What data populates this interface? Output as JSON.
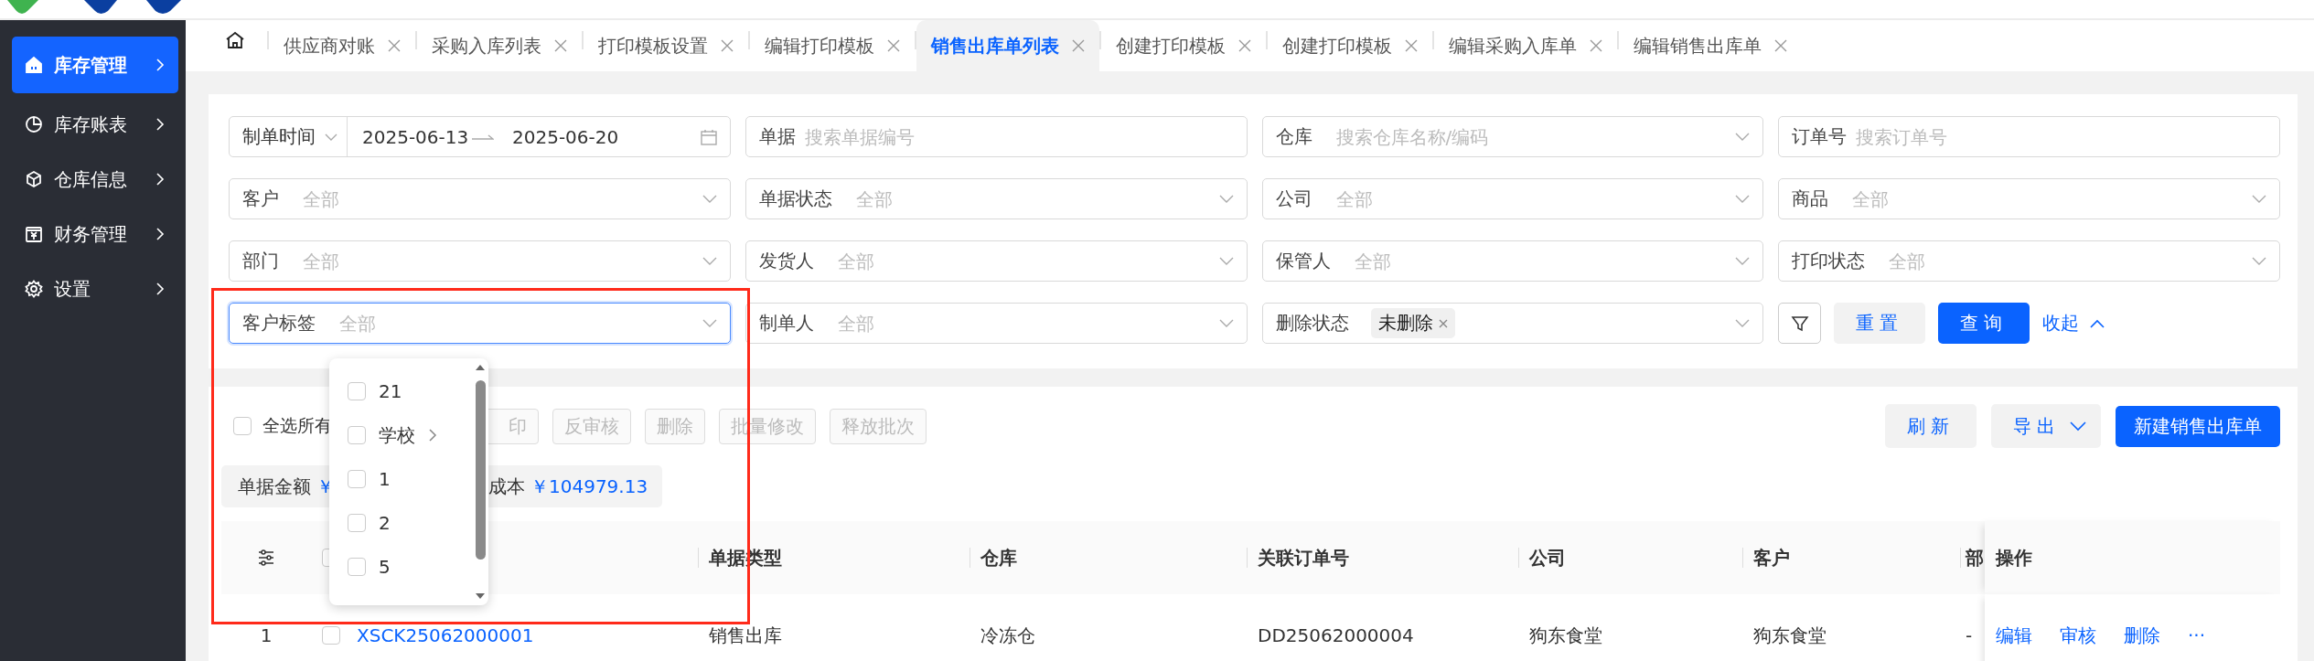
{
  "sidebar": {
    "items": [
      {
        "label": "库存管理",
        "selected": true
      },
      {
        "label": "库存账表",
        "selected": false
      },
      {
        "label": "仓库信息",
        "selected": false
      },
      {
        "label": "财务管理",
        "selected": false
      },
      {
        "label": "设置",
        "selected": false
      }
    ]
  },
  "tabs": [
    {
      "label": "供应商对账",
      "selected": false
    },
    {
      "label": "采购入库列表",
      "selected": false
    },
    {
      "label": "打印模板设置",
      "selected": false
    },
    {
      "label": "编辑打印模板",
      "selected": false
    },
    {
      "label": "销售出库单列表",
      "selected": true
    },
    {
      "label": "创建打印模板",
      "selected": false
    },
    {
      "label": "创建打印模板",
      "selected": false
    },
    {
      "label": "编辑采购入库单",
      "selected": false
    },
    {
      "label": "编辑销售出库单",
      "selected": false
    }
  ],
  "filters": [
    {
      "kind": "date_range",
      "label": "制单时间",
      "start": "2025-06-13",
      "end": "2025-06-20",
      "focused": false
    },
    {
      "kind": "text",
      "label": "单据",
      "placeholder": "搜索单据编号",
      "focused": false
    },
    {
      "kind": "select",
      "label": "仓库",
      "placeholder": "搜索仓库名称/编码",
      "focused": false
    },
    {
      "kind": "text",
      "label": "订单号",
      "placeholder": "搜索订单号",
      "focused": false
    },
    {
      "kind": "select",
      "label": "客户",
      "placeholder": "全部",
      "focused": false
    },
    {
      "kind": "select",
      "label": "单据状态",
      "placeholder": "全部",
      "focused": false
    },
    {
      "kind": "select",
      "label": "公司",
      "placeholder": "全部",
      "focused": false
    },
    {
      "kind": "select",
      "label": "商品",
      "placeholder": "全部",
      "focused": false
    },
    {
      "kind": "select",
      "label": "部门",
      "placeholder": "全部",
      "focused": false
    },
    {
      "kind": "select",
      "label": "发货人",
      "placeholder": "全部",
      "focused": false
    },
    {
      "kind": "select",
      "label": "保管人",
      "placeholder": "全部",
      "focused": false
    },
    {
      "kind": "select",
      "label": "打印状态",
      "placeholder": "全部",
      "focused": false
    },
    {
      "kind": "select",
      "label": "客户标签",
      "placeholder": "全部",
      "focused": true
    },
    {
      "kind": "select",
      "label": "制单人",
      "placeholder": "全部",
      "focused": false
    },
    {
      "kind": "tag_select",
      "label": "删除状态",
      "tag": "未删除",
      "focused": false
    }
  ],
  "filter_actions": {
    "reset": "重置",
    "query": "查询",
    "collapse": "收起"
  },
  "toolbar": {
    "select_all": {
      "label": "全选所有",
      "checked": false
    },
    "buttons": [
      {
        "label": "印",
        "disabled": true
      },
      {
        "label": "反审核",
        "disabled": true
      },
      {
        "label": "删除",
        "disabled": true
      },
      {
        "label": "批量修改",
        "disabled": true
      },
      {
        "label": "释放批次",
        "disabled": true
      }
    ],
    "refresh": "刷新",
    "export": "导出",
    "create": "新建销售出库单"
  },
  "summary": [
    {
      "label": "单据金额",
      "value": "￥"
    },
    {
      "label": "成本",
      "value": "￥104979.13"
    }
  ],
  "table": {
    "header_checked": false,
    "columns": [
      "单据类型",
      "仓库",
      "关联订单号",
      "公司",
      "客户",
      "部"
    ],
    "action_column": "操作",
    "rows": [
      {
        "index": "1",
        "selected": false,
        "number": "XSCK25062000001",
        "cells": [
          "销售出库",
          "冷冻仓",
          "DD25062000004",
          "狗东食堂",
          "狗东食堂",
          "-"
        ],
        "actions": [
          "编辑",
          "审核",
          "删除",
          "···"
        ]
      }
    ]
  },
  "dropdown": {
    "options": [
      {
        "label": "21",
        "checked": false,
        "has_children": false
      },
      {
        "label": "学校",
        "checked": false,
        "has_children": true
      },
      {
        "label": "1",
        "checked": false,
        "has_children": false
      },
      {
        "label": "2",
        "checked": false,
        "has_children": false
      },
      {
        "label": "5",
        "checked": false,
        "has_children": false
      }
    ]
  }
}
